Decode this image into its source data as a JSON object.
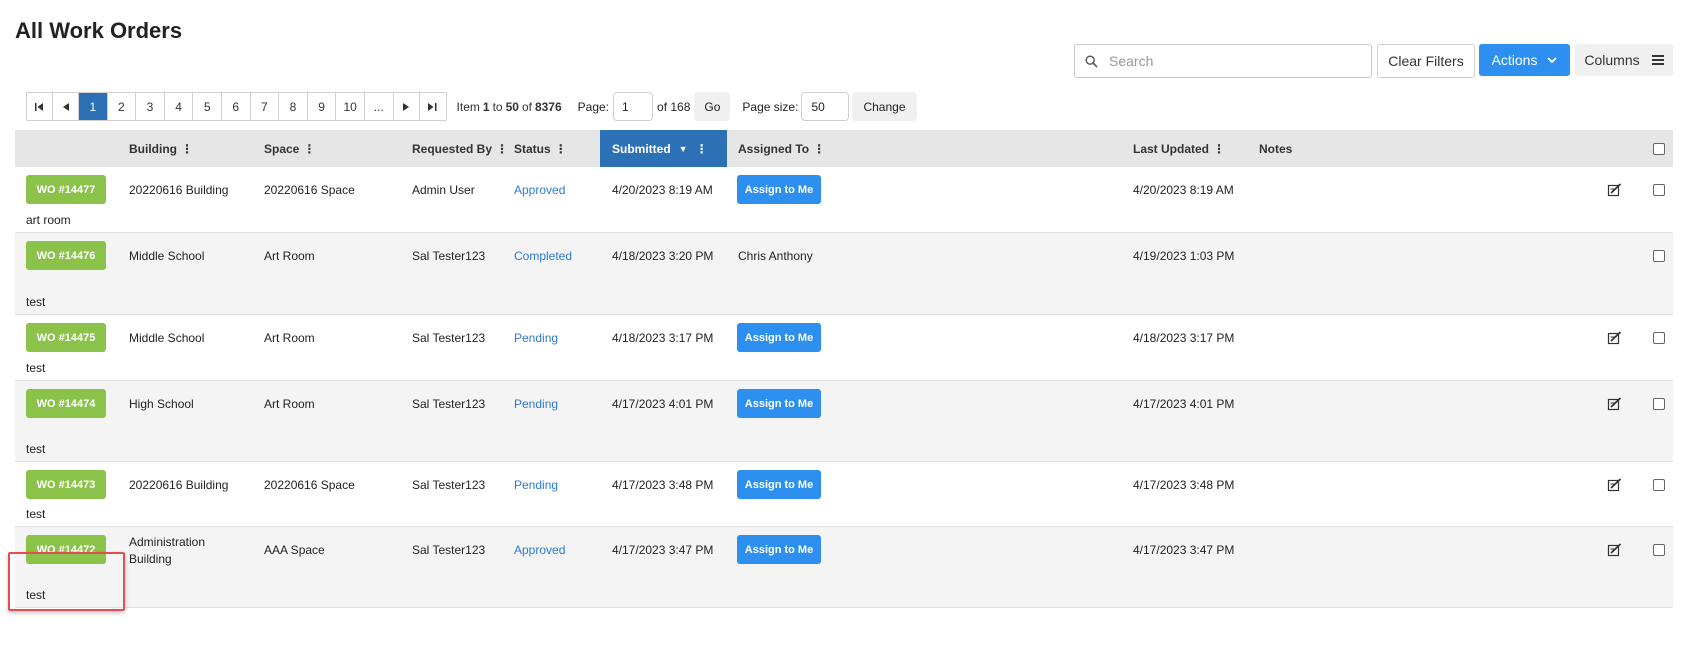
{
  "page": {
    "title": "All Work Orders"
  },
  "toolbar": {
    "search_placeholder": "Search",
    "clear_filters_label": "Clear Filters",
    "actions_label": "Actions",
    "columns_label": "Columns"
  },
  "pager": {
    "pages": [
      "1",
      "2",
      "3",
      "4",
      "5",
      "6",
      "7",
      "8",
      "9",
      "10",
      "..."
    ],
    "active_page": "1",
    "item_prefix": "Item",
    "item_from": "1",
    "item_to_word": "to",
    "item_to": "50",
    "item_of_word": "of",
    "item_total": "8376",
    "page_label": "Page:",
    "page_value": "1",
    "page_of": "of 168",
    "go_label": "Go",
    "page_size_label": "Page size:",
    "page_size_value": "50",
    "change_label": "Change"
  },
  "table": {
    "columns": {
      "building": "Building",
      "space": "Space",
      "requested_by": "Requested By",
      "status": "Status",
      "submitted": "Submitted",
      "assigned_to": "Assigned To",
      "last_updated": "Last Updated",
      "notes": "Notes"
    },
    "assign_label": "Assign to Me",
    "rows": [
      {
        "wo": "WO #14477",
        "building": "20220616 Building",
        "space": "20220616 Space",
        "requested_by": "Admin User",
        "status": "Approved",
        "submitted": "4/20/2023 8:19 AM",
        "assigned_to": "",
        "last_updated": "4/20/2023 8:19 AM",
        "note": "art room"
      },
      {
        "wo": "WO #14476",
        "building": "Middle School",
        "space": "Art Room",
        "requested_by": "Sal Tester123",
        "status": "Completed",
        "submitted": "4/18/2023 3:20 PM",
        "assigned_to": "Chris Anthony",
        "last_updated": "4/19/2023 1:03 PM",
        "note": "test"
      },
      {
        "wo": "WO #14475",
        "building": "Middle School",
        "space": "Art Room",
        "requested_by": "Sal Tester123",
        "status": "Pending",
        "submitted": "4/18/2023 3:17 PM",
        "assigned_to": "",
        "last_updated": "4/18/2023 3:17 PM",
        "note": "test"
      },
      {
        "wo": "WO #14474",
        "building": "High School",
        "space": "Art Room",
        "requested_by": "Sal Tester123",
        "status": "Pending",
        "submitted": "4/17/2023 4:01 PM",
        "assigned_to": "",
        "last_updated": "4/17/2023 4:01 PM",
        "note": "test"
      },
      {
        "wo": "WO #14473",
        "building": "20220616 Building",
        "space": "20220616 Space",
        "requested_by": "Sal Tester123",
        "status": "Pending",
        "submitted": "4/17/2023 3:48 PM",
        "assigned_to": "",
        "last_updated": "4/17/2023 3:48 PM",
        "note": "test"
      },
      {
        "wo": "WO #14472",
        "building": "Administration Building",
        "space": "AAA Space",
        "requested_by": "Sal Tester123",
        "status": "Approved",
        "submitted": "4/17/2023 3:47 PM",
        "assigned_to": "",
        "last_updated": "4/17/2023 3:47 PM",
        "note": "test"
      }
    ]
  },
  "colors": {
    "accent_blue": "#2d8ff0",
    "wo_green": "#8bc34a",
    "sorted_header": "#2c70b6",
    "status_link": "#2d7bd6",
    "highlight": "#e05050"
  }
}
